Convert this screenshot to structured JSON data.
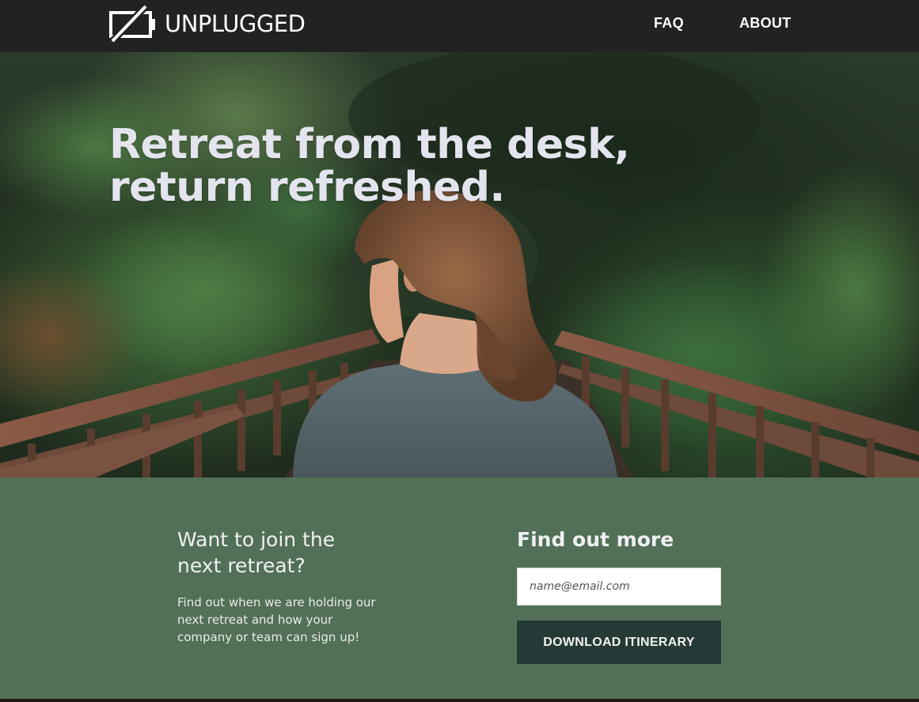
{
  "brand": {
    "logo_icon": "battery-off-icon",
    "name": "UNPLUGGED"
  },
  "nav": {
    "faq": "FAQ",
    "about": "ABOUT"
  },
  "hero": {
    "title_line1": "Retreat from the desk,",
    "title_line2": "return refreshed."
  },
  "signup": {
    "left_heading_line1": "Want to join the",
    "left_heading_line2": "next retreat?",
    "left_text": "Find out when we are holding our next retreat and how your company or team can sign up!",
    "right_heading": "Find out more",
    "email_placeholder": "name@email.com",
    "button_label": "DOWNLOAD ITINERARY"
  },
  "colors": {
    "nav_bg": "#222222",
    "section_bg": "#527057",
    "button_bg": "#253a36",
    "text_light": "#f0f0f4"
  }
}
